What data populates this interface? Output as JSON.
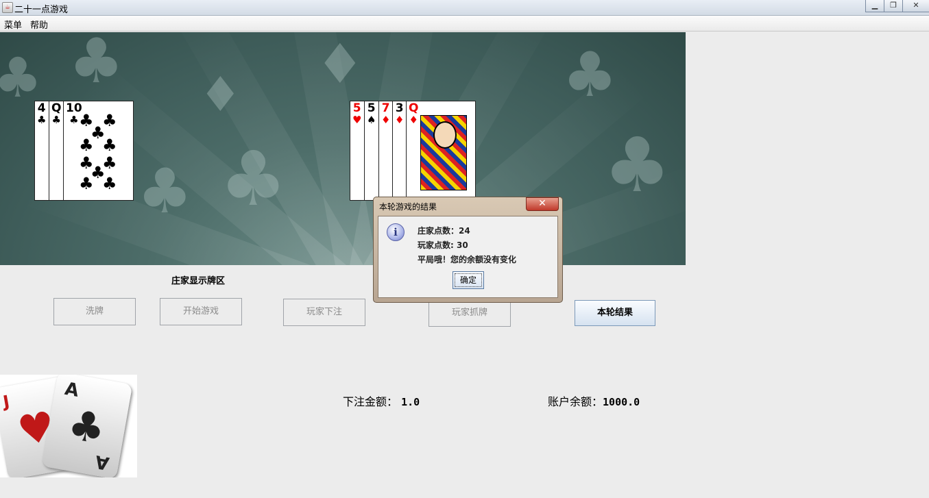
{
  "window": {
    "title": "二十一点游戏",
    "minimize_icon": "minimize-icon",
    "maximize_icon": "restore-icon",
    "close_icon": "close-icon"
  },
  "menu": {
    "items": [
      {
        "label": "菜单"
      },
      {
        "label": "帮助"
      }
    ]
  },
  "table": {
    "dealer_cards": [
      {
        "rank": "4",
        "suit": "♣",
        "color": "black"
      },
      {
        "rank": "Q",
        "suit": "♣",
        "color": "black"
      },
      {
        "rank": "10",
        "suit": "♣",
        "color": "black"
      }
    ],
    "player_cards": [
      {
        "rank": "5",
        "suit": "♥",
        "color": "red"
      },
      {
        "rank": "5",
        "suit": "♠",
        "color": "black"
      },
      {
        "rank": "7",
        "suit": "♦",
        "color": "red"
      },
      {
        "rank": "3",
        "suit": "♦",
        "color": "black"
      },
      {
        "rank": "Q",
        "suit": "♦",
        "color": "red"
      }
    ]
  },
  "dealer_zone_label": "庄家显示牌区",
  "buttons": {
    "shuffle": "洗牌",
    "start": "开始游戏",
    "bet": "玩家下注",
    "draw": "玩家抓牌",
    "result": "本轮结果"
  },
  "bet": {
    "label": "下注金额：",
    "value": "1.0"
  },
  "balance": {
    "label": "账户余额：",
    "value": "1000.0"
  },
  "logo_cards": {
    "left_rank": "J",
    "left_suit": "♥",
    "right_rank": "A",
    "right_suit": "♣"
  },
  "dialog": {
    "title": "本轮游戏的结果",
    "icon": "info-icon",
    "dealer_points_label": "庄家点数：",
    "dealer_points": "24",
    "player_points_label": "玩家点数:",
    "player_points": "30",
    "message": "平局哦！您的余额没有变化",
    "ok_label": "确定"
  },
  "colors": {
    "table_felt": "#4d6d69",
    "card_red": "#e00000",
    "dialog_frame": "#c8b6a2",
    "close_button": "#c0392b"
  }
}
